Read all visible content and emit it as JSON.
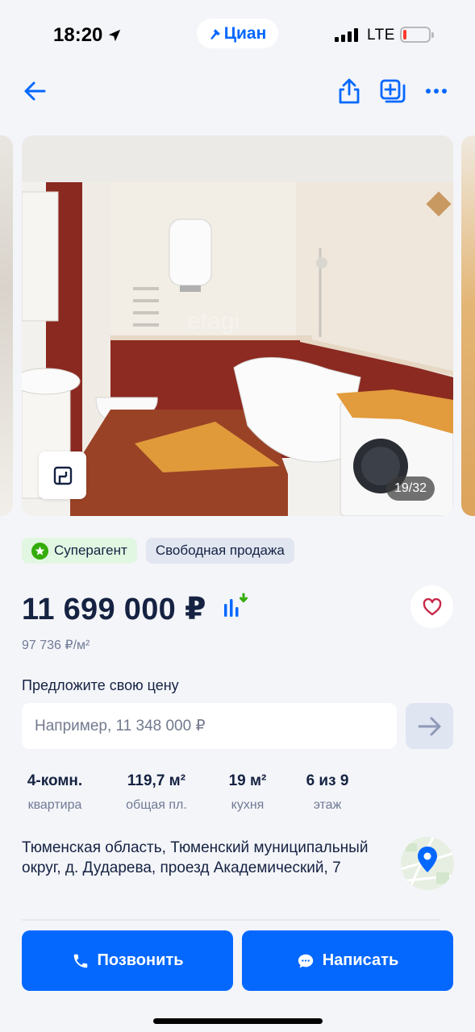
{
  "status_bar": {
    "time": "18:20",
    "network": "LTE",
    "brand": "Циан"
  },
  "nav": {
    "back": "back-arrow-icon",
    "share": "share-icon",
    "compare": "add-to-compare-icon",
    "more": "more-icon"
  },
  "gallery": {
    "counter": "19/32",
    "watermark": "etagi"
  },
  "tags": [
    {
      "label": "Суперагент"
    },
    {
      "label": "Свободная продажа"
    }
  ],
  "price": {
    "value": "11 699 000 ₽",
    "per_m2": "97 736 ₽/м²"
  },
  "offer": {
    "label": "Предложите свою цену",
    "placeholder": "Например, 11 348 000 ₽",
    "value": ""
  },
  "facts": [
    {
      "value": "4-комн.",
      "label": "квартира"
    },
    {
      "value": "119,7 м²",
      "label": "общая пл."
    },
    {
      "value": "19 м²",
      "label": "кухня"
    },
    {
      "value": "6 из 9",
      "label": "этаж"
    }
  ],
  "address": "Тюменская область, Тюменский муниципальный округ, д. Дударева, проезд Академический, 7",
  "actions": {
    "call": "Позвонить",
    "message": "Написать"
  },
  "colors": {
    "accent": "#0468ff",
    "text": "#152242",
    "secondary": "#707a95",
    "background": "#f4f5f9",
    "superagent": "#34ac0a",
    "favorite": "#c8294a"
  }
}
